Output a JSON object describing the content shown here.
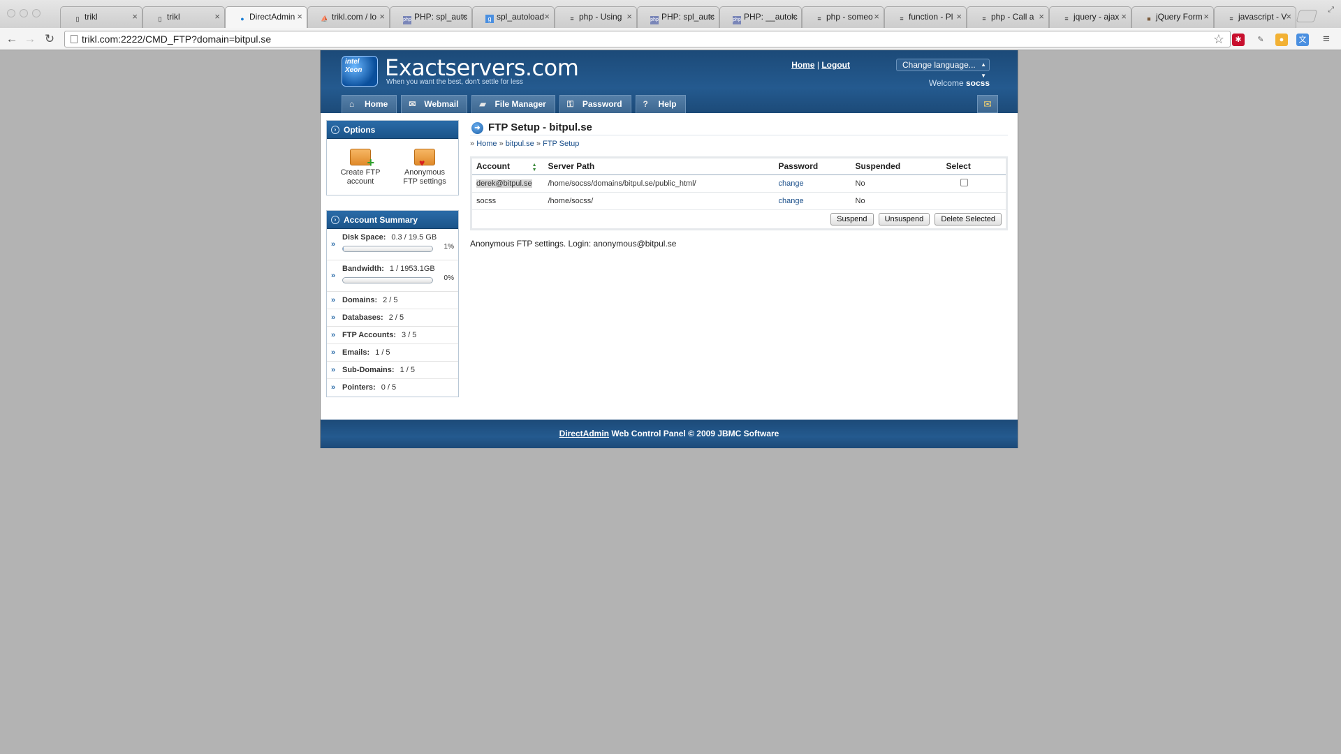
{
  "browser": {
    "tabs": [
      {
        "title": "trikl",
        "icon": "page-icon"
      },
      {
        "title": "trikl",
        "icon": "page-icon"
      },
      {
        "title": "DirectAdmin",
        "icon": "globe-icon",
        "active": true
      },
      {
        "title": "trikl.com / lo",
        "icon": "pma-icon"
      },
      {
        "title": "PHP: spl_autc",
        "icon": "php-icon"
      },
      {
        "title": "spl_autoload",
        "icon": "google-icon"
      },
      {
        "title": "php - Using",
        "icon": "stackoverflow-icon"
      },
      {
        "title": "PHP: spl_autc",
        "icon": "php-icon"
      },
      {
        "title": "PHP: __autolc",
        "icon": "php-icon"
      },
      {
        "title": "php - someo",
        "icon": "stackoverflow-icon"
      },
      {
        "title": "function - Pl",
        "icon": "stackoverflow-icon"
      },
      {
        "title": "php - Call a",
        "icon": "stackoverflow-icon"
      },
      {
        "title": "jquery - ajax",
        "icon": "stackoverflow-icon"
      },
      {
        "title": "jQuery Form",
        "icon": "avatar-icon"
      },
      {
        "title": "javascript - V",
        "icon": "stackoverflow-icon"
      }
    ],
    "url": "trikl.com:2222/CMD_FTP?domain=bitpul.se"
  },
  "header": {
    "logo_text": "Exactservers.com",
    "logo_badge": "intel Xeon",
    "tagline": "When you want the best, don't settle for less",
    "home_link": "Home",
    "separator": "|",
    "logout_link": "Logout",
    "language_select": "Change language...",
    "welcome_label": "Welcome",
    "username": "socss"
  },
  "nav": [
    {
      "label": "Home",
      "icon": "home-icon"
    },
    {
      "label": "Webmail",
      "icon": "mail-icon"
    },
    {
      "label": "File Manager",
      "icon": "folder-icon"
    },
    {
      "label": "Password",
      "icon": "key-icon"
    },
    {
      "label": "Help",
      "icon": "help-icon"
    }
  ],
  "sidebar": {
    "options_title": "Options",
    "options": [
      {
        "label": "Create FTP account",
        "icon": "folder-add-icon"
      },
      {
        "label": "Anonymous FTP settings",
        "icon": "folder-heart-icon"
      }
    ],
    "summary_title": "Account Summary",
    "disk": {
      "label": "Disk Space:",
      "value": "0.3 / 19.5 GB",
      "percent": "1%",
      "fraction": 0.01
    },
    "bandwidth": {
      "label": "Bandwidth:",
      "value": "1 / 1953.1GB",
      "percent": "0%",
      "fraction": 0.0
    },
    "rows": [
      {
        "label": "Domains:",
        "value": "2 / 5"
      },
      {
        "label": "Databases:",
        "value": "2 / 5"
      },
      {
        "label": "FTP Accounts:",
        "value": "3 / 5"
      },
      {
        "label": "Emails:",
        "value": "1 / 5"
      },
      {
        "label": "Sub-Domains:",
        "value": "1 / 5"
      },
      {
        "label": "Pointers:",
        "value": "0 / 5"
      }
    ]
  },
  "main": {
    "title": "FTP Setup - bitpul.se",
    "breadcrumb": {
      "prefix": "»",
      "items": [
        "Home",
        "bitpul.se",
        "FTP Setup"
      ],
      "separator": "»"
    },
    "columns": [
      "Account",
      "Server Path",
      "Password",
      "Suspended",
      "Select"
    ],
    "rows": [
      {
        "account": "derek@bitpul.se",
        "path": "/home/socss/domains/bitpul.se/public_html/",
        "password": "change",
        "suspended": "No",
        "selectable": true
      },
      {
        "account": "socss",
        "path": "/home/socss/",
        "password": "change",
        "suspended": "No",
        "selectable": false
      }
    ],
    "buttons": {
      "suspend": "Suspend",
      "unsuspend": "Unsuspend",
      "delete": "Delete Selected"
    },
    "anonymous_text": "Anonymous FTP settings. Login: anonymous@bitpul.se"
  },
  "footer": {
    "link": "DirectAdmin",
    "text": "Web Control Panel © 2009 JBMC Software"
  }
}
